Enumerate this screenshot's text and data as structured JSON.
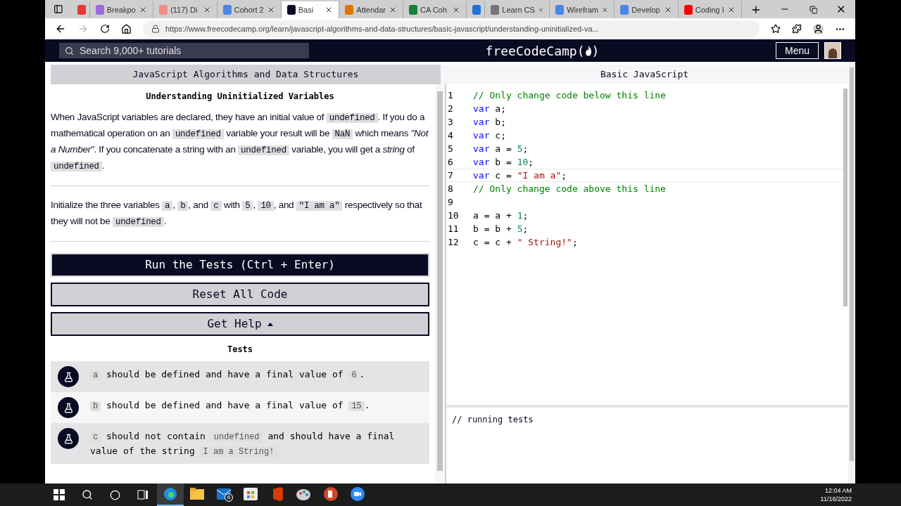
{
  "browser": {
    "tabs": [
      {
        "color": "#e53935",
        "selected": false
      },
      {
        "title": "Breakpo",
        "color": "#9c6ade",
        "selected": false
      },
      {
        "title": "(117) Di",
        "color": "#f28b82",
        "selected": false
      },
      {
        "title": "Cohort 2",
        "color": "#4a86e8",
        "selected": false
      },
      {
        "title": "Basi",
        "color": "#0a0a23",
        "selected": true
      },
      {
        "title": "Attendar",
        "color": "#e37400",
        "selected": false
      },
      {
        "title": "CA Coh",
        "color": "#188038",
        "selected": false
      },
      {
        "color": "#1e73d8",
        "selected": false
      },
      {
        "title": "Learn CS",
        "color": "#757575",
        "selected": false
      },
      {
        "title": "Wirefram",
        "color": "#4a86e8",
        "selected": false
      },
      {
        "title": "Develop",
        "color": "#4a86e8",
        "selected": false
      },
      {
        "title": "Coding I",
        "color": "#ff0000",
        "selected": false
      }
    ],
    "url": "https://www.freecodecamp.org/learn/javascript-algorithms-and-data-structures/basic-javascript/understanding-uninitialized-va..."
  },
  "nav": {
    "search_placeholder": "Search 9,000+ tutorials",
    "logo_prefix": "freeCodeCamp(",
    "logo_suffix": ")",
    "menu": "Menu"
  },
  "breadcrumb": [
    "JavaScript Algorithms and Data Structures",
    "Basic JavaScript"
  ],
  "challenge": {
    "title": "Understanding Uninitialized Variables",
    "paragraphs": [
      [
        {
          "kind": "text",
          "text": "When JavaScript variables are declared, they have an initial value of "
        },
        {
          "kind": "code",
          "text": "undefined"
        },
        {
          "kind": "text",
          "text": ". If you do a mathematical operation on an "
        },
        {
          "kind": "code",
          "text": "undefined"
        },
        {
          "kind": "text",
          "text": " variable your result will be "
        },
        {
          "kind": "code",
          "text": "NaN"
        },
        {
          "kind": "text",
          "text": " which means "
        },
        {
          "kind": "italic",
          "text": "\"Not a Number\""
        },
        {
          "kind": "text",
          "text": ". If you concatenate a string with an "
        },
        {
          "kind": "code",
          "text": "undefined"
        },
        {
          "kind": "text",
          "text": " variable, you will get a "
        },
        {
          "kind": "italic",
          "text": "string"
        },
        {
          "kind": "text",
          "text": " of "
        },
        {
          "kind": "code",
          "text": "undefined"
        },
        {
          "kind": "text",
          "text": "."
        }
      ],
      [
        {
          "kind": "text",
          "text": "Initialize the three variables "
        },
        {
          "kind": "code",
          "text": "a"
        },
        {
          "kind": "text",
          "text": ", "
        },
        {
          "kind": "code",
          "text": "b"
        },
        {
          "kind": "text",
          "text": ", and "
        },
        {
          "kind": "code",
          "text": "c"
        },
        {
          "kind": "text",
          "text": " with "
        },
        {
          "kind": "code",
          "text": "5"
        },
        {
          "kind": "text",
          "text": ", "
        },
        {
          "kind": "code",
          "text": "10"
        },
        {
          "kind": "text",
          "text": ", and "
        },
        {
          "kind": "code",
          "text": "\"I am a\""
        },
        {
          "kind": "text",
          "text": " respectively so that they will not be "
        },
        {
          "kind": "code",
          "text": "undefined"
        },
        {
          "kind": "text",
          "text": "."
        }
      ]
    ],
    "buttons": [
      {
        "kind": "primary",
        "label": "Run the Tests (Ctrl + Enter)"
      },
      {
        "kind": "secondary",
        "label": "Reset All Code"
      },
      {
        "kind": "dropdown",
        "label": "Get Help"
      }
    ],
    "tests_heading": "Tests",
    "tests": [
      [
        {
          "kind": "code",
          "text": "a"
        },
        {
          "kind": "text",
          "text": " should be defined and have a final value of "
        },
        {
          "kind": "code",
          "text": "6"
        },
        {
          "kind": "text",
          "text": "."
        }
      ],
      [
        {
          "kind": "code",
          "text": "b"
        },
        {
          "kind": "text",
          "text": " should be defined and have a final value of "
        },
        {
          "kind": "code",
          "text": "15"
        },
        {
          "kind": "text",
          "text": "."
        }
      ],
      [
        {
          "kind": "code",
          "text": "c"
        },
        {
          "kind": "text",
          "text": " should not contain "
        },
        {
          "kind": "code",
          "text": "undefined"
        },
        {
          "kind": "text",
          "text": " and should have a final value of the string "
        },
        {
          "kind": "code",
          "text": "I am a String!"
        }
      ]
    ]
  },
  "editor": {
    "lines": [
      {
        "number": "1",
        "active": false,
        "tokens": [
          {
            "kind": "comment",
            "text": "// Only change code below this line"
          }
        ]
      },
      {
        "number": "2",
        "active": false,
        "tokens": [
          {
            "kind": "keyword",
            "text": "var"
          },
          {
            "kind": "plain",
            "text": " a;"
          }
        ]
      },
      {
        "number": "3",
        "active": false,
        "tokens": [
          {
            "kind": "keyword",
            "text": "var"
          },
          {
            "kind": "plain",
            "text": " b;"
          }
        ]
      },
      {
        "number": "4",
        "active": false,
        "tokens": [
          {
            "kind": "keyword",
            "text": "var"
          },
          {
            "kind": "plain",
            "text": " c;"
          }
        ]
      },
      {
        "number": "5",
        "active": false,
        "tokens": [
          {
            "kind": "keyword",
            "text": "var"
          },
          {
            "kind": "plain",
            "text": " a = "
          },
          {
            "kind": "number",
            "text": "5"
          },
          {
            "kind": "plain",
            "text": ";"
          }
        ]
      },
      {
        "number": "6",
        "active": false,
        "tokens": [
          {
            "kind": "keyword",
            "text": "var"
          },
          {
            "kind": "plain",
            "text": " b = "
          },
          {
            "kind": "number",
            "text": "10"
          },
          {
            "kind": "plain",
            "text": ";"
          }
        ]
      },
      {
        "number": "7",
        "active": true,
        "tokens": [
          {
            "kind": "keyword",
            "text": "var"
          },
          {
            "kind": "plain",
            "text": " c = "
          },
          {
            "kind": "string",
            "text": "\"I am a\""
          },
          {
            "kind": "plain",
            "text": ";"
          }
        ]
      },
      {
        "number": "8",
        "active": false,
        "tokens": [
          {
            "kind": "comment",
            "text": "// Only change code above this line"
          }
        ]
      },
      {
        "number": "9",
        "active": false
      },
      {
        "number": "10",
        "active": false,
        "tokens": [
          {
            "kind": "plain",
            "text": "a = a + "
          },
          {
            "kind": "number",
            "text": "1"
          },
          {
            "kind": "plain",
            "text": ";"
          }
        ]
      },
      {
        "number": "11",
        "active": false,
        "tokens": [
          {
            "kind": "plain",
            "text": "b = b + "
          },
          {
            "kind": "number",
            "text": "5"
          },
          {
            "kind": "plain",
            "text": ";"
          }
        ]
      },
      {
        "number": "12",
        "active": false,
        "tokens": [
          {
            "kind": "plain",
            "text": "c = c + "
          },
          {
            "kind": "string",
            "text": "\" String!\""
          },
          {
            "kind": "plain",
            "text": ";"
          }
        ]
      }
    ],
    "console": "// running tests"
  },
  "taskbar": {
    "apps": [
      {
        "kind": "browser",
        "selected": true
      },
      {
        "kind": "folder",
        "selected": false
      },
      {
        "kind": "mail",
        "selected": false,
        "badge": "6"
      },
      {
        "kind": "store",
        "selected": false
      },
      {
        "kind": "office",
        "selected": false
      },
      {
        "kind": "paint",
        "selected": false
      },
      {
        "kind": "slides",
        "selected": false
      },
      {
        "kind": "video",
        "selected": false
      }
    ],
    "time": "12:04 AM",
    "date": "11/16/2022"
  }
}
